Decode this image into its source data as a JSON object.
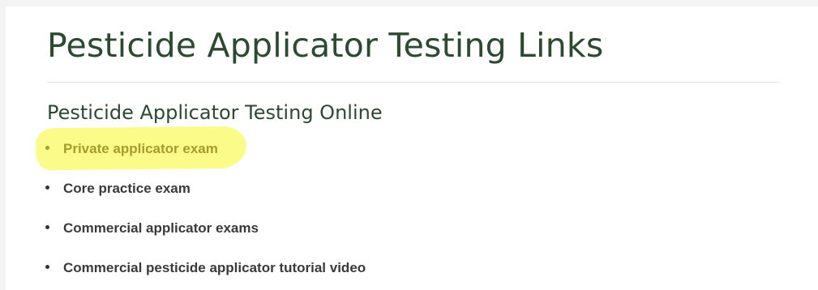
{
  "page": {
    "title": "Pesticide Applicator Testing Links",
    "section_title": "Pesticide Applicator Testing Online"
  },
  "links": [
    {
      "label": "Private applicator exam",
      "highlighted": true
    },
    {
      "label": "Core practice exam",
      "highlighted": false
    },
    {
      "label": "Commercial applicator exams",
      "highlighted": false
    },
    {
      "label": "Commercial pesticide applicator tutorial video",
      "highlighted": false
    }
  ],
  "colors": {
    "heading": "#2b4a2f",
    "link_text": "#3a3a3a",
    "highlight": "#fbfb8a",
    "highlighted_link_text": "#a79b2f",
    "background": "#f4f4f4",
    "content_background": "#ffffff"
  }
}
